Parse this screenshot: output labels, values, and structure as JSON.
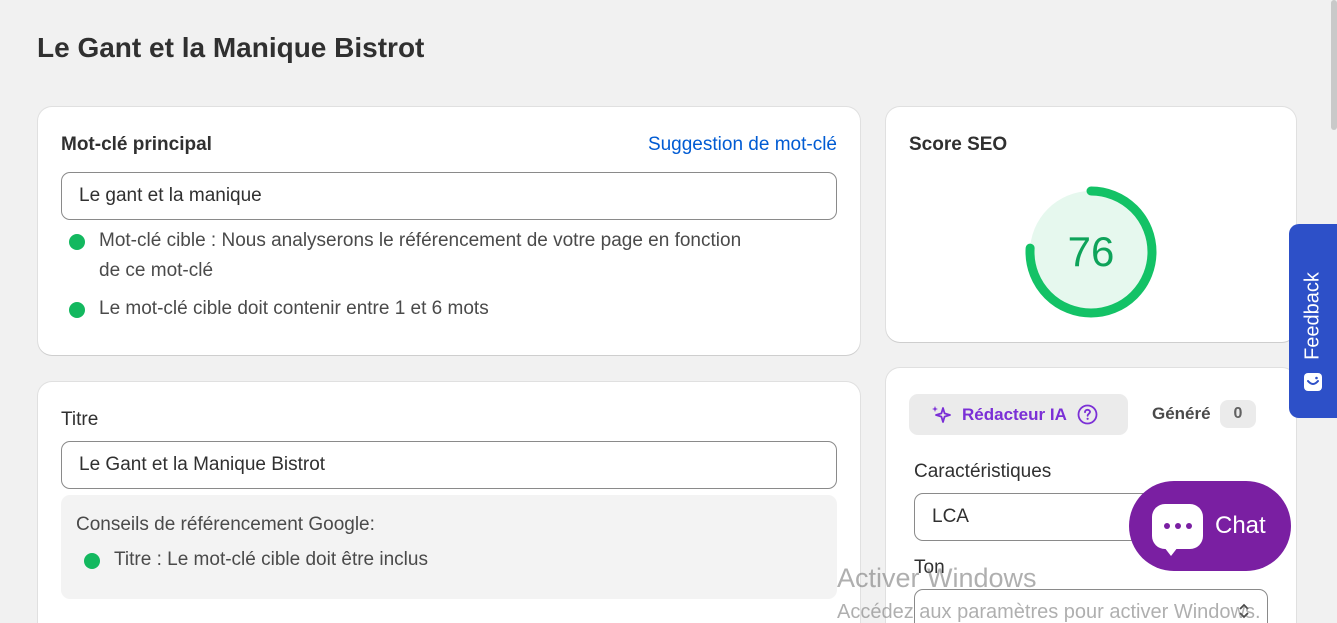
{
  "page": {
    "title": "Le Gant et la Manique Bistrot"
  },
  "keyword_card": {
    "heading": "Mot-clé principal",
    "suggestion_link": "Suggestion de mot-clé",
    "input_value": "Le gant et la manique",
    "checks": [
      {
        "line1": "Mot-clé cible : Nous analyserons le référencement de votre page en fonction",
        "line2": "de ce mot-clé"
      },
      {
        "line1": "Le mot-clé cible doit contenir entre 1 et 6 mots"
      }
    ]
  },
  "title_card": {
    "label": "Titre",
    "input_value": "Le Gant et la Manique Bistrot",
    "tips_heading": "Conseils de référencement Google:",
    "tips": [
      "Titre : Le mot-clé cible doit être inclus"
    ]
  },
  "seo_card": {
    "heading": "Score SEO",
    "score": "76",
    "score_fraction": 0.76,
    "colors": {
      "ring": "#13c266",
      "ring_fill": "#e6f8ee",
      "score_text": "#0ea35a"
    }
  },
  "ai_card": {
    "writer_label": "Rédacteur IA",
    "generated_label": "Généré",
    "generated_count": "0",
    "characteristics_label": "Caractéristiques",
    "characteristics_value": "LCA",
    "tone_label": "Ton"
  },
  "feedback_tab": {
    "label": "Feedback"
  },
  "chat": {
    "label": "Chat"
  },
  "watermark": {
    "line1": "Activer Windows",
    "line2": "Accédez aux paramètres pour activer Windows."
  },
  "icons": {
    "ai": "sparkle-icon",
    "help": "question-circle-icon",
    "feedback": "smile-icon",
    "chat": "chat-bubble-icon",
    "status": "green-dot-icon"
  },
  "colors": {
    "accent_link": "#005bd3",
    "ai_purple": "#7b2fd6",
    "feedback_blue": "#2d50c8",
    "chat_purple": "#7a1fa2",
    "ok_green": "#13b85f"
  }
}
